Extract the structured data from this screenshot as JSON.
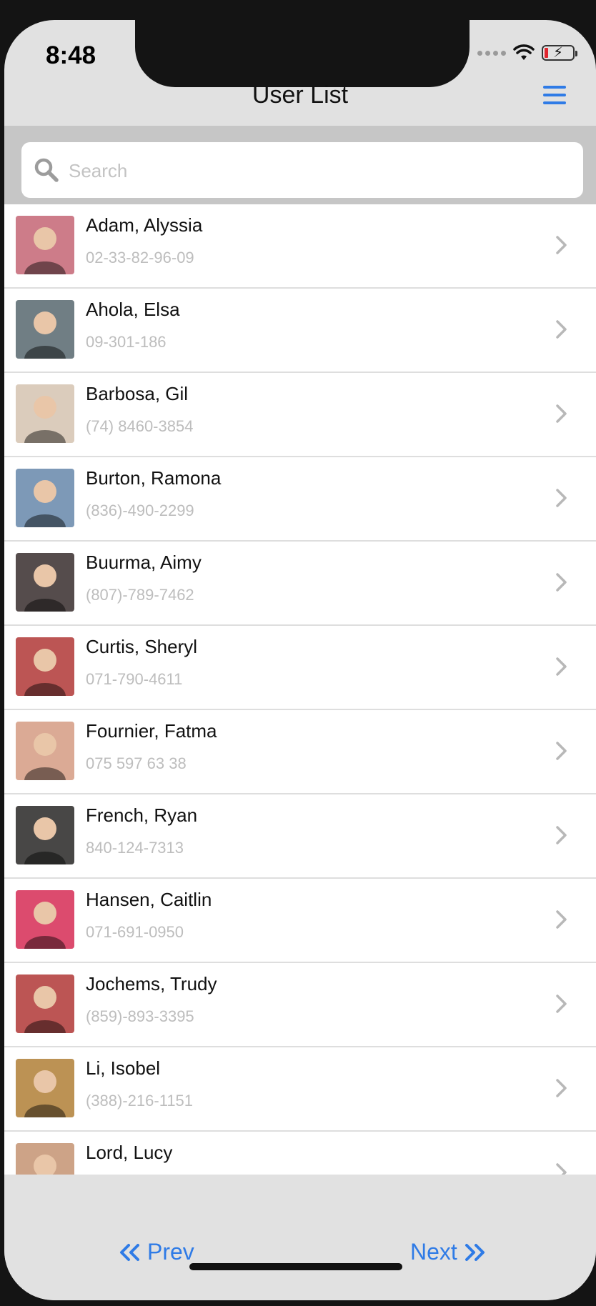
{
  "status_bar": {
    "time": "8:48"
  },
  "navbar": {
    "title": "User List"
  },
  "search": {
    "placeholder": "Search"
  },
  "users": [
    {
      "name": "Adam, Alyssia",
      "phone": "02-33-82-96-09",
      "color": "#c86a7a"
    },
    {
      "name": "Ahola, Elsa",
      "phone": "09-301-186",
      "color": "#5a6c74"
    },
    {
      "name": "Barbosa, Gil",
      "phone": "(74) 8460-3854",
      "color": "#d8c8b6"
    },
    {
      "name": "Burton, Ramona",
      "phone": "(836)-490-2299",
      "color": "#6a8cb0"
    },
    {
      "name": "Buurma, Aimy",
      "phone": "(807)-789-7462",
      "color": "#3b3133"
    },
    {
      "name": "Curtis, Sheryl",
      "phone": "071-790-4611",
      "color": "#b43c3c"
    },
    {
      "name": "Fournier, Fatma",
      "phone": "075 597 63 38",
      "color": "#d8a088"
    },
    {
      "name": "French, Ryan",
      "phone": "840-124-7313",
      "color": "#2b2b2b"
    },
    {
      "name": "Hansen, Caitlin",
      "phone": "071-691-0950",
      "color": "#d9305a"
    },
    {
      "name": "Jochems, Trudy",
      "phone": "(859)-893-3395",
      "color": "#b43c3c"
    },
    {
      "name": "Li, Isobel",
      "phone": "(388)-216-1151",
      "color": "#b4843c"
    },
    {
      "name": "Lord, Lucy",
      "phone": "",
      "color": "#c89878"
    }
  ],
  "pager": {
    "prev_label": "Prev",
    "next_label": "Next"
  },
  "colors": {
    "accent": "#2f7be6",
    "bar_bg": "#e1e1e1",
    "search_bg": "#c6c6c6"
  },
  "icons": [
    "search-icon",
    "menu-icon",
    "chevron-right-icon",
    "double-chevron-left-icon",
    "double-chevron-right-icon",
    "wifi-icon",
    "battery-charging-icon"
  ]
}
